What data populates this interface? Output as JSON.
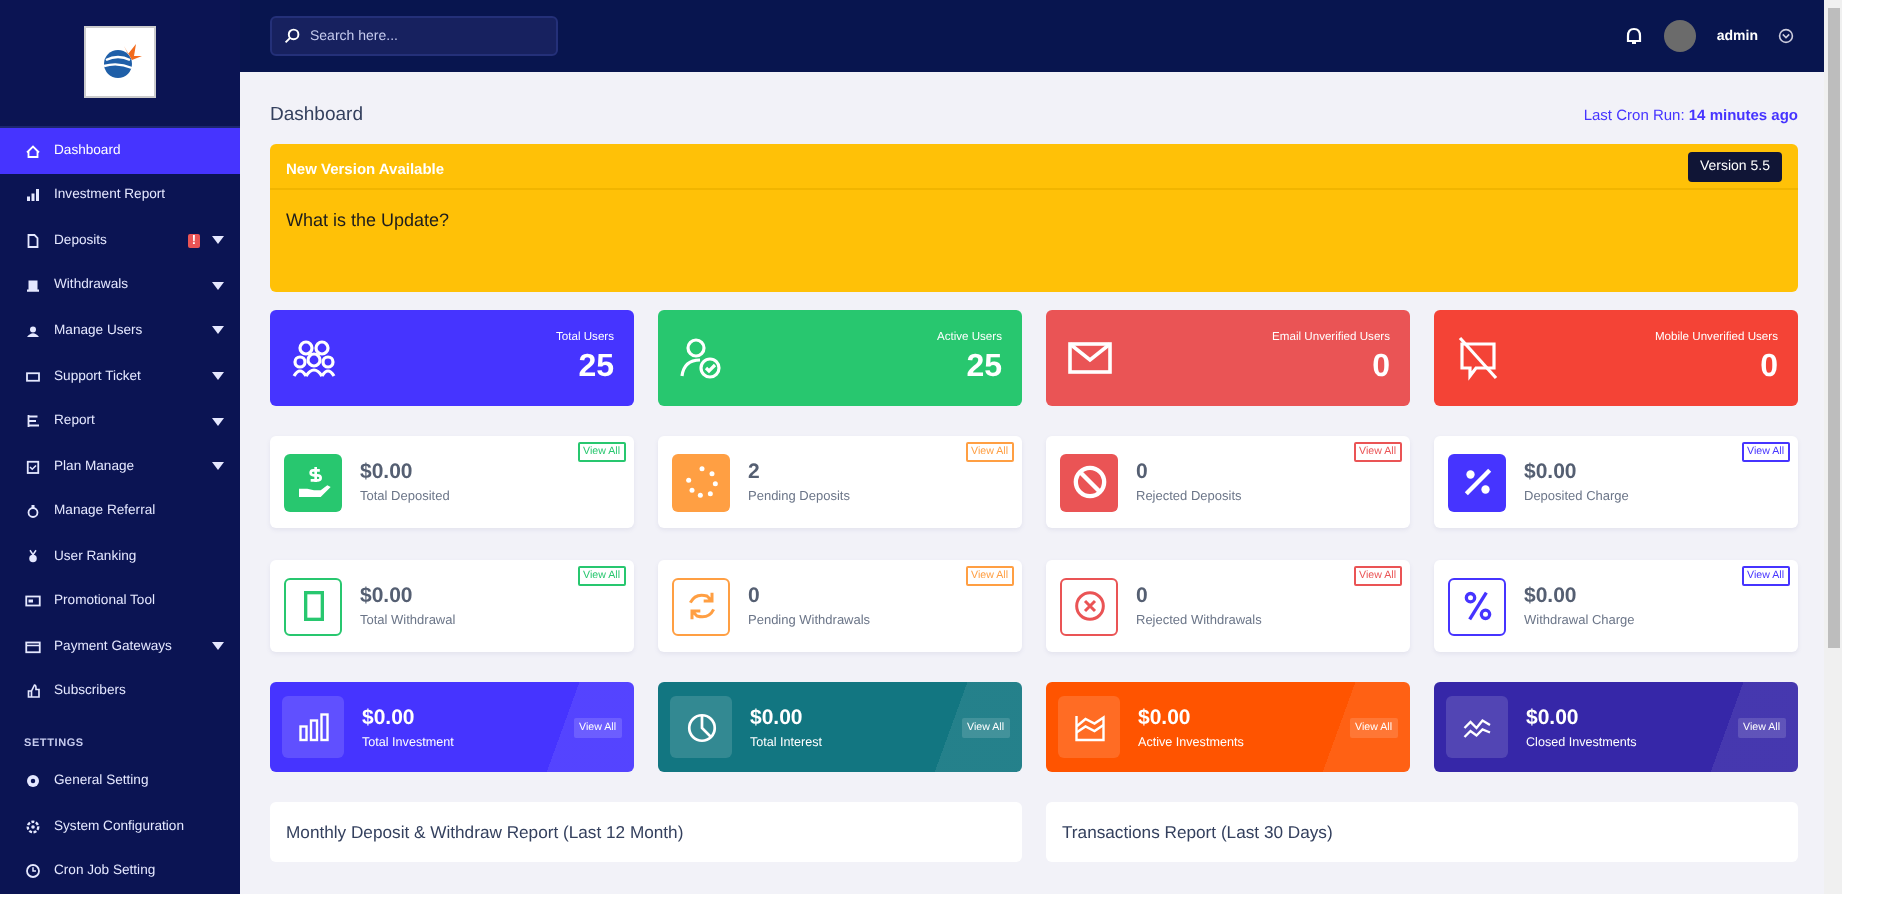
{
  "sidebar": {
    "items": [
      {
        "label": "Dashboard",
        "selected": true,
        "has_submenu": false
      },
      {
        "label": "Investment Report",
        "selected": false,
        "has_submenu": false
      },
      {
        "label": "Deposits",
        "selected": false,
        "has_submenu": true,
        "badge": "!"
      },
      {
        "label": "Withdrawals",
        "selected": false,
        "has_submenu": true
      },
      {
        "label": "Manage Users",
        "selected": false,
        "has_submenu": true
      },
      {
        "label": "Support Ticket",
        "selected": false,
        "has_submenu": true
      },
      {
        "label": "Report",
        "selected": false,
        "has_submenu": true
      },
      {
        "label": "Plan Manage",
        "selected": false,
        "has_submenu": true
      },
      {
        "label": "Manage Referral",
        "selected": false,
        "has_submenu": false
      },
      {
        "label": "User Ranking",
        "selected": false,
        "has_submenu": false
      },
      {
        "label": "Promotional Tool",
        "selected": false,
        "has_submenu": false
      },
      {
        "label": "Payment Gateways",
        "selected": false,
        "has_submenu": true
      },
      {
        "label": "Subscribers",
        "selected": false,
        "has_submenu": false
      }
    ],
    "section_title": "SETTINGS",
    "settings_items": [
      {
        "label": "General Setting",
        "selected": false,
        "has_submenu": false
      },
      {
        "label": "System Configuration",
        "selected": false,
        "has_submenu": false
      },
      {
        "label": "Cron Job Setting",
        "selected": false,
        "has_submenu": false
      }
    ]
  },
  "search": {
    "placeholder": "Search here..."
  },
  "user": {
    "name": "admin"
  },
  "page_title": "Dashboard",
  "cron": {
    "label": "Last Cron Run:",
    "value": "14 minutes ago"
  },
  "alert": {
    "title": "New Version Available",
    "version": "Version 5.5",
    "question": "What is the Update?"
  },
  "user_stats": [
    {
      "label": "Total Users",
      "value": "25",
      "color": "#4634ff"
    },
    {
      "label": "Active Users",
      "value": "25",
      "color": "#28c76f"
    },
    {
      "label": "Email Unverified Users",
      "value": "0",
      "color": "#ea5455"
    },
    {
      "label": "Mobile Unverified Users",
      "value": "0",
      "color": "#f44336"
    }
  ],
  "widgets": [
    {
      "kind": "filled",
      "value": "$0.00",
      "label": "Total Deposited",
      "link": "View All",
      "color": "#28c76f"
    },
    {
      "kind": "filled",
      "value": "2",
      "label": "Pending Deposits",
      "link": "View All",
      "color": "#ff9f43"
    },
    {
      "kind": "filled",
      "value": "0",
      "label": "Rejected Deposits",
      "link": "View All",
      "color": "#ea5455"
    },
    {
      "kind": "filled",
      "value": "$0.00",
      "label": "Deposited Charge",
      "link": "View All",
      "color": "#4634ff"
    },
    {
      "kind": "outline",
      "value": "$0.00",
      "label": "Total Withdrawal",
      "link": "View All",
      "color": "#28c76f"
    },
    {
      "kind": "outline",
      "value": "0",
      "label": "Pending Withdrawals",
      "link": "View All",
      "color": "#ff9f43"
    },
    {
      "kind": "outline",
      "value": "0",
      "label": "Rejected Withdrawals",
      "link": "View All",
      "color": "#ea5455"
    },
    {
      "kind": "outline",
      "value": "$0.00",
      "label": "Withdrawal Charge",
      "link": "View All",
      "color": "#4634ff"
    }
  ],
  "investments": [
    {
      "value": "$0.00",
      "label": "Total Investment",
      "link": "View All",
      "color": "#4634ff"
    },
    {
      "value": "$0.00",
      "label": "Total Interest",
      "link": "View All",
      "color": "#127681"
    },
    {
      "value": "$0.00",
      "label": "Active Investments",
      "link": "View All",
      "color": "#ff5400"
    },
    {
      "value": "$0.00",
      "label": "Closed Investments",
      "link": "View All",
      "color": "#3627a8"
    }
  ],
  "reports": [
    {
      "title": "Monthly Deposit & Withdraw Report (Last 12 Month)"
    },
    {
      "title": "Transactions Report (Last 30 Days)"
    }
  ]
}
